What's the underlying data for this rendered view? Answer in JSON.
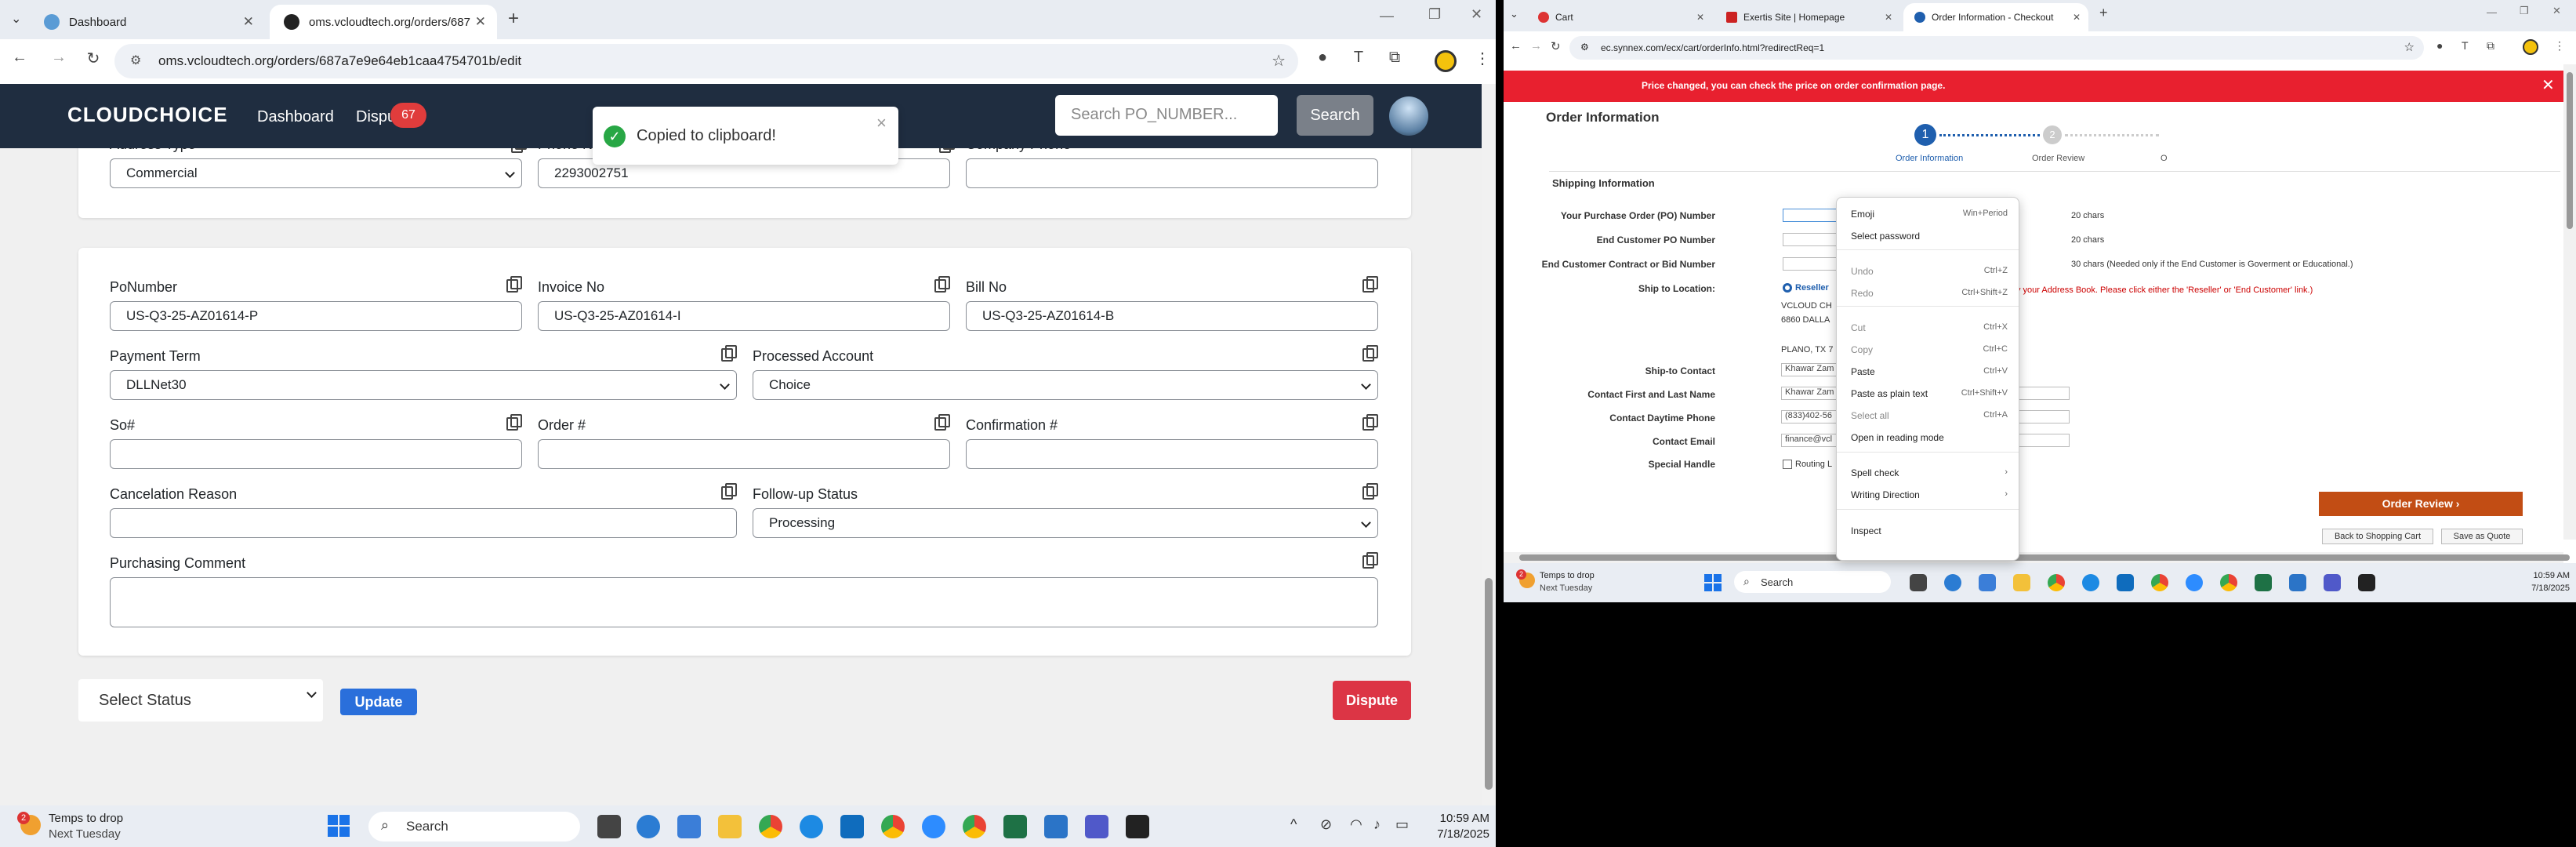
{
  "left_browser": {
    "tabs": [
      {
        "label": "Dashboard"
      },
      {
        "label": "oms.vcloudtech.org/orders/687"
      }
    ],
    "url": "oms.vcloudtech.org/orders/687a7e9e64eb1caa4754701b/edit",
    "nav": {
      "logo": "CLOUDCHOICE",
      "dashboard": "Dashboard",
      "dispute": "Dispu",
      "badge": "67",
      "search_placeholder": "Search PO_NUMBER...",
      "search_btn": "Search"
    },
    "toast": {
      "message": "Copied to clipboard!",
      "close": "×"
    },
    "top_card": {
      "address_type_label": "Address Type",
      "address_type": "Commercial",
      "phone_label": "Phone N",
      "phone": "2293002751",
      "company_phone_label": "Company Phone",
      "company_phone": ""
    },
    "form": {
      "po_label": "PoNumber",
      "po": "US-Q3-25-AZ01614-P",
      "invoice_label": "Invoice No",
      "invoice": "US-Q3-25-AZ01614-I",
      "bill_label": "Bill No",
      "bill": "US-Q3-25-AZ01614-B",
      "payment_label": "Payment Term",
      "payment": "DLLNet30",
      "processed_label": "Processed Account",
      "processed": "Choice",
      "so_label": "So#",
      "so": "",
      "order_label": "Order #",
      "order": "",
      "confirm_label": "Confirmation #",
      "confirm": "",
      "cancel_label": "Cancelation Reason",
      "cancel": "",
      "followup_label": "Follow-up Status",
      "followup": "Processing",
      "comment_label": "Purchasing Comment",
      "comment": ""
    },
    "actions": {
      "status": "Select Status",
      "update": "Update",
      "dispute": "Dispute"
    },
    "taskbar": {
      "weather_badge": "2",
      "weather1": "Temps to drop",
      "weather2": "Next Tuesday",
      "search": "Search",
      "time": "10:59 AM",
      "date": "7/18/2025"
    }
  },
  "right_browser": {
    "tabs": [
      {
        "label": "Cart"
      },
      {
        "label": "Exertis Site | Homepage"
      },
      {
        "label": "Order Information - Checkout"
      }
    ],
    "url": "ec.synnex.com/ecx/cart/orderInfo.html?redirectReq=1",
    "alert": "Price changed, you can check the price on order confirmation page.",
    "page_title": "Order Information",
    "steps": [
      {
        "num": "1",
        "label": "Order Information"
      },
      {
        "num": "2",
        "label": "Order Review"
      },
      {
        "label": "O"
      }
    ],
    "section": "Shipping Information",
    "fields": [
      {
        "label": "Your Purchase Order (PO) Number",
        "note": "20 chars"
      },
      {
        "label": "End Customer PO Number",
        "note": "20 chars"
      },
      {
        "label": "End Customer Contract or Bid Number",
        "note": "30 chars (Needed only if the End Customer is Goverment or Educational.)"
      }
    ],
    "ship_to_label": "Ship to Location:",
    "reseller": "Reseller",
    "address_note": "y your Address Book. Please click either the 'Reseller' or 'End Customer' link.)",
    "addr1": "VCLOUD CH",
    "addr2": "6860 DALLA",
    "addr3": "PLANO, TX 7",
    "ship_contact_label": "Ship-to Contact",
    "ship_contact": "Khawar Zam",
    "contact_name_label": "Contact First and Last Name",
    "contact_name": "Khawar Zam",
    "phone_label": "Contact Daytime Phone",
    "phone": "(833)402-56",
    "email_label": "Contact Email",
    "email": "finance@vcl",
    "special_label": "Special Handle",
    "special": "Routing L",
    "order_review_btn": "Order Review",
    "back_btn": "Back to Shopping Cart",
    "save_btn": "Save as Quote",
    "context_menu": [
      {
        "label": "Emoji",
        "shortcut": "Win+Period"
      },
      {
        "label": "Select password",
        "shortcut": ""
      },
      {
        "label": "Undo",
        "shortcut": "Ctrl+Z"
      },
      {
        "label": "Redo",
        "shortcut": "Ctrl+Shift+Z"
      },
      {
        "label": "Cut",
        "shortcut": "Ctrl+X"
      },
      {
        "label": "Copy",
        "shortcut": "Ctrl+C"
      },
      {
        "label": "Paste",
        "shortcut": "Ctrl+V"
      },
      {
        "label": "Paste as plain text",
        "shortcut": "Ctrl+Shift+V"
      },
      {
        "label": "Select all",
        "shortcut": "Ctrl+A"
      },
      {
        "label": "Open in reading mode",
        "shortcut": ""
      },
      {
        "label": "Spell check",
        "shortcut": "›"
      },
      {
        "label": "Writing Direction",
        "shortcut": "›"
      },
      {
        "label": "Inspect",
        "shortcut": ""
      }
    ],
    "taskbar": {
      "weather_badge": "2",
      "weather1": "Temps to drop",
      "weather2": "Next Tuesday",
      "search": "Search",
      "time": "10:59 AM",
      "date": "7/18/2025"
    }
  },
  "colors": {
    "navbar": "#1f2d40",
    "blue": "#2a6fdb",
    "red": "#dc3545",
    "alert": "#e8202f",
    "orange": "#c24d14"
  }
}
